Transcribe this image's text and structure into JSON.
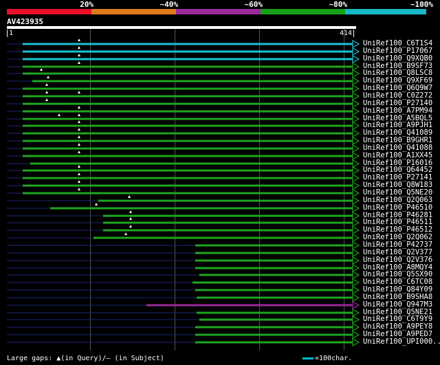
{
  "legend": [
    {
      "label": "",
      "color": "#e8102a"
    },
    {
      "label": "20%",
      "color": "#e0781c"
    },
    {
      "label": "~40%",
      "color": "#9a2a9a"
    },
    {
      "label": "~60%",
      "color": "#18a018"
    },
    {
      "label": "~80%",
      "color": "#18b8c8"
    },
    {
      "label": "~100%",
      "color": ""
    }
  ],
  "query": {
    "name": "AV423935",
    "start": "1",
    "end": "414"
  },
  "colors": {
    "cyan": "#19c3d3",
    "green": "#1fa61f",
    "purple": "#9a2a9a",
    "navy": "#1c2873",
    "triangle": "#ffffcc"
  },
  "hits": [
    {
      "name": "UniRef100_C6T1S4",
      "color": "cyan",
      "s": 33,
      "e": 513,
      "gaps": [
        115
      ]
    },
    {
      "name": "UniRef100_P17067",
      "color": "cyan",
      "s": 33,
      "e": 513,
      "gaps": [
        115
      ]
    },
    {
      "name": "UniRef100_Q9XQB0",
      "color": "cyan",
      "s": 33,
      "e": 513,
      "gaps": [
        115
      ]
    },
    {
      "name": "UniRef100_B9SF73",
      "color": "green",
      "s": 33,
      "e": 513,
      "gaps": [
        115
      ]
    },
    {
      "name": "UniRef100_Q8LSC8",
      "color": "green",
      "s": 33,
      "e": 513,
      "gaps": [
        60
      ]
    },
    {
      "name": "UniRef100_Q9XF69",
      "color": "green",
      "s": 47,
      "e": 513,
      "gaps": [
        70
      ]
    },
    {
      "name": "UniRef100_Q6Q9W7",
      "color": "green",
      "s": 33,
      "e": 513,
      "gaps": [
        68
      ]
    },
    {
      "name": "UniRef100_C0Z272",
      "color": "green",
      "s": 33,
      "e": 513,
      "gaps": [
        68,
        115
      ]
    },
    {
      "name": "UniRef100_P27140",
      "color": "green",
      "s": 33,
      "e": 513,
      "gaps": [
        68
      ]
    },
    {
      "name": "UniRef100_A7PM94",
      "color": "green",
      "s": 33,
      "e": 513,
      "gaps": [
        115
      ]
    },
    {
      "name": "UniRef100_A5BQL5",
      "color": "green",
      "s": 33,
      "e": 513,
      "gaps": [
        86,
        115
      ]
    },
    {
      "name": "UniRef100_A9PJH1",
      "color": "green",
      "s": 33,
      "e": 513,
      "gaps": [
        115
      ]
    },
    {
      "name": "UniRef100_Q41089",
      "color": "green",
      "s": 33,
      "e": 513,
      "gaps": [
        115
      ]
    },
    {
      "name": "UniRef100_B9GHR1",
      "color": "green",
      "s": 33,
      "e": 513,
      "gaps": [
        115
      ]
    },
    {
      "name": "UniRef100_Q41088",
      "color": "green",
      "s": 33,
      "e": 513,
      "gaps": [
        115
      ]
    },
    {
      "name": "UniRef100_A1XX45",
      "color": "green",
      "s": 33,
      "e": 513,
      "gaps": [
        115
      ]
    },
    {
      "name": "UniRef100_P16016",
      "color": "green",
      "s": 44,
      "e": 513,
      "gaps": []
    },
    {
      "name": "UniRef100_Q64452",
      "color": "green",
      "s": 33,
      "e": 513,
      "gaps": [
        115
      ]
    },
    {
      "name": "UniRef100_P27141",
      "color": "green",
      "s": 33,
      "e": 513,
      "gaps": [
        115
      ]
    },
    {
      "name": "UniRef100_Q8W183",
      "color": "green",
      "s": 33,
      "e": 513,
      "gaps": [
        115
      ]
    },
    {
      "name": "UniRef100_Q5NE20",
      "color": "green",
      "s": 33,
      "e": 513,
      "gaps": [
        115
      ]
    },
    {
      "name": "UniRef100_Q2Q063",
      "color": "green",
      "s": 143,
      "e": 513,
      "gaps": [
        188
      ]
    },
    {
      "name": "UniRef100_P46510",
      "color": "green",
      "s": 73,
      "e": 513,
      "gaps": [
        140
      ]
    },
    {
      "name": "UniRef100_P46281",
      "color": "green",
      "s": 150,
      "e": 513,
      "gaps": [
        190
      ]
    },
    {
      "name": "UniRef100_P46511",
      "color": "green",
      "s": 150,
      "e": 513,
      "gaps": [
        190
      ]
    },
    {
      "name": "UniRef100_P46512",
      "color": "green",
      "s": 150,
      "e": 513,
      "gaps": [
        190
      ]
    },
    {
      "name": "UniRef100_Q2Q062",
      "color": "green",
      "s": 136,
      "e": 513,
      "gaps": [
        183
      ]
    },
    {
      "name": "UniRef100_P42737",
      "color": "green",
      "s": 284,
      "e": 513,
      "gaps": []
    },
    {
      "name": "UniRef100_Q2V377",
      "color": "green",
      "s": 284,
      "e": 513,
      "gaps": []
    },
    {
      "name": "UniRef100_Q2V376",
      "color": "green",
      "s": 284,
      "e": 513,
      "gaps": []
    },
    {
      "name": "UniRef100_A8MQY4",
      "color": "green",
      "s": 284,
      "e": 513,
      "gaps": []
    },
    {
      "name": "UniRef100_Q5SX90",
      "color": "green",
      "s": 290,
      "e": 513,
      "gaps": []
    },
    {
      "name": "UniRef100_C6TC08",
      "color": "green",
      "s": 280,
      "e": 513,
      "gaps": []
    },
    {
      "name": "UniRef100_Q84Y09",
      "color": "green",
      "s": 284,
      "e": 513,
      "gaps": []
    },
    {
      "name": "UniRef100_B9SHA8",
      "color": "green",
      "s": 286,
      "e": 513,
      "gaps": []
    },
    {
      "name": "UniRef100_Q947M3",
      "color": "purple",
      "s": 213,
      "e": 513,
      "gaps": []
    },
    {
      "name": "UniRef100_Q5NE21",
      "color": "green",
      "s": 286,
      "e": 513,
      "gaps": []
    },
    {
      "name": "UniRef100_C6T9Y9",
      "color": "green",
      "s": 290,
      "e": 513,
      "gaps": []
    },
    {
      "name": "UniRef100_A9PEY8",
      "color": "green",
      "s": 284,
      "e": 513,
      "gaps": []
    },
    {
      "name": "UniRef100_A9PED7",
      "color": "green",
      "s": 284,
      "e": 513,
      "gaps": []
    },
    {
      "name": "UniRef100_UPI000..",
      "color": "green",
      "s": 284,
      "e": 513,
      "gaps": []
    }
  ],
  "footer": {
    "gaps_text": "Large gaps: ▲(in Query)/– (in Subject)",
    "scale_text": "=100char."
  }
}
